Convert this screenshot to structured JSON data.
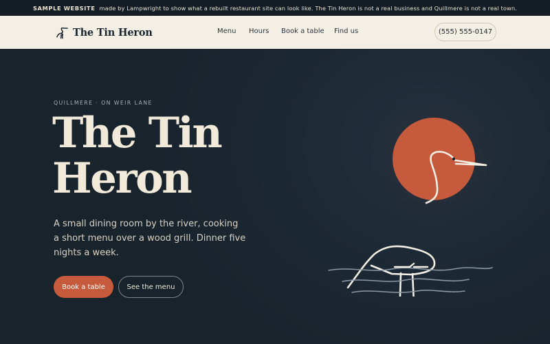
{
  "banner": {
    "tag": "SAMPLE WEBSITE",
    "text": "made by Lampwright to show what a rebuilt restaurant site can look like. The Tin Heron is not a real business and Quillmere is not a real town."
  },
  "nav": {
    "brand": "The Tin Heron",
    "brand_icon": "heron-icon",
    "links": [
      "Menu",
      "Hours",
      "Book a table",
      "Find us"
    ],
    "phone": "(555) 555-0147"
  },
  "hero": {
    "eyebrow": "QUILLMERE · ON WEIR LANE",
    "title": "The Tin Heron",
    "lead": "A small dining room by the river, cooking a short menu over a wood grill. Dinner five nights a week.",
    "primary_button": "Book a table",
    "secondary_button": "See the menu",
    "illustration": "heron-and-sun-illustration"
  },
  "colors": {
    "accent": "#c65a3c",
    "cream": "#f4efe4",
    "dark": "#1b2630",
    "water": "#8a9aa6"
  }
}
